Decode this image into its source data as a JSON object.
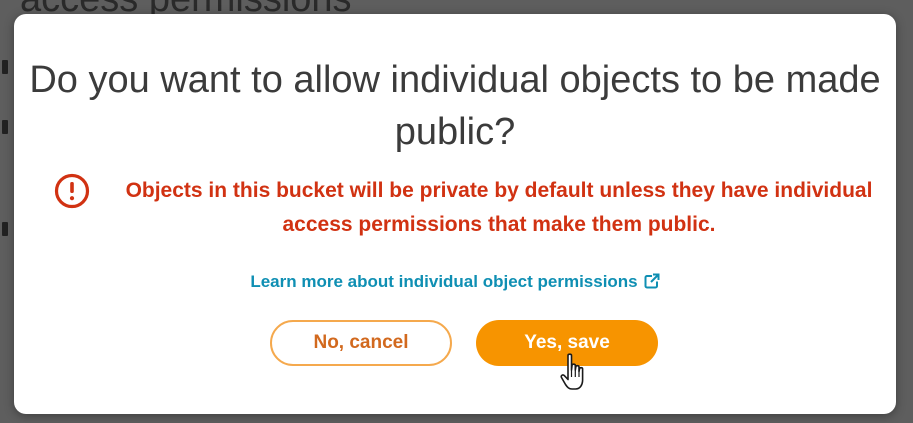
{
  "background": {
    "heading": "access permissions"
  },
  "dialog": {
    "title": "Do you want to allow individual objects to be made public?",
    "warning_icon": "alert-circle-icon",
    "warning_text": "Objects in this bucket will be private by default unless they have individual access permissions that make them public.",
    "learn_more_link": "Learn more about individual object permissions",
    "external_link_icon": "external-link-icon",
    "cancel_label": "No, cancel",
    "save_label": "Yes, save"
  },
  "colors": {
    "warning": "#d13212",
    "link": "#0f8fb3",
    "accent": "#f79400",
    "cancel_border": "#f5a94d",
    "title": "#3b3b3b"
  },
  "cursor": "hand-pointer-icon"
}
